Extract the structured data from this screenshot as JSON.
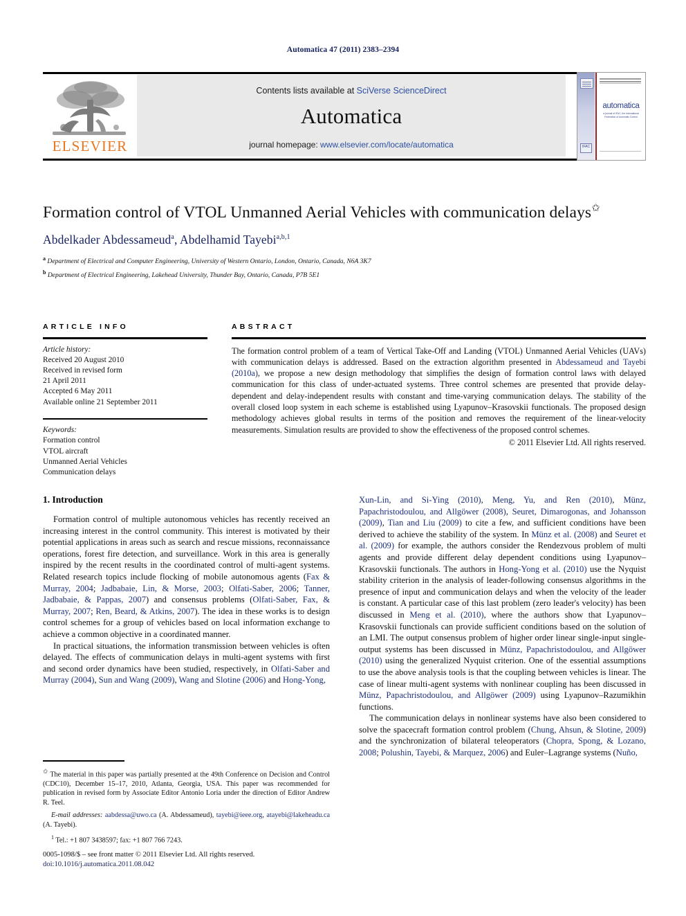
{
  "running_head": "Automatica 47 (2011) 2383–2394",
  "masthead": {
    "contents_prefix": "Contents lists available at ",
    "sciencedirect": "SciVerse ScienceDirect",
    "journal_name": "Automatica",
    "homepage_prefix": "journal homepage: ",
    "homepage_url": "www.elsevier.com/locate/automatica",
    "publisher_logo_text": "ELSEVIER",
    "cover": {
      "title": "automatica",
      "subtitle": "a journal of IFAC, the International Federation of Automatic Control",
      "ifac_label": "IFAC"
    }
  },
  "title": {
    "text": "Formation control of VTOL Unmanned Aerial Vehicles with communication delays",
    "footnote_marker": "✩"
  },
  "authors": {
    "line": "Abdelkader Abdessameud",
    "author1": "Abdelkader Abdessameud",
    "author1_sup": "a",
    "author2": "Abdelhamid Tayebi",
    "author2_sup": "a,b,1",
    "separator": ", "
  },
  "affiliations": [
    {
      "marker": "a",
      "text": "Department of Electrical and Computer Engineering, University of Western Ontario, London, Ontario, Canada, N6A 3K7"
    },
    {
      "marker": "b",
      "text": "Department of Electrical Engineering, Lakehead University, Thunder Bay, Ontario, Canada, P7B 5E1"
    }
  ],
  "article_info": {
    "heading": "ARTICLE INFO",
    "history_label": "Article history:",
    "history": [
      "Received 20 August 2010",
      "Received in revised form",
      "21 April 2011",
      "Accepted 6 May 2011",
      "Available online 21 September 2011"
    ],
    "keywords_label": "Keywords:",
    "keywords": [
      "Formation control",
      "VTOL aircraft",
      "Unmanned Aerial Vehicles",
      "Communication delays"
    ]
  },
  "abstract": {
    "heading": "ABSTRACT",
    "part1": "The formation control problem of a team of Vertical Take-Off and Landing (VTOL) Unmanned Aerial Vehicles (UAVs) with communication delays is addressed. Based on the extraction algorithm presented in ",
    "cite1": "Abdessameud and Tayebi (2010a)",
    "part2": ", we propose a new design methodology that simplifies the design of formation control laws with delayed communication for this class of under-actuated systems. Three control schemes are presented that provide delay-dependent and delay-independent results with constant and time-varying communication delays. The stability of the overall closed loop system in each scheme is established using Lyapunov–Krasovskii functionals. The proposed design methodology achieves global results in terms of the position and removes the requirement of the linear-velocity measurements. Simulation results are provided to show the effectiveness of the proposed control schemes.",
    "copyright": "© 2011 Elsevier Ltd. All rights reserved."
  },
  "body": {
    "section_heading": "1. Introduction",
    "left": {
      "p1_a": "Formation control of multiple autonomous vehicles has recently received an increasing interest in the control community. This interest is motivated by their potential applications in areas such as search and rescue missions, reconnaissance operations, forest fire detection, and surveillance. Work in this area is generally inspired by the recent results in the coordinated control of multi-agent systems. Related research topics include flocking of mobile autonomous agents (",
      "p1_c1": "Fax & Murray, 2004",
      "p1_b": "; ",
      "p1_c2": "Jadbabaie, Lin, & Morse, 2003",
      "p1_c3": "Olfati-Saber, 2006",
      "p1_c4": "Tanner, Jadbabaie, & Pappas, 2007",
      "p1_d": ") and consensus problems (",
      "p1_c5": "Olfati-Saber, Fax, & Murray, 2007",
      "p1_c6": "Ren, Beard, & Atkins, 2007",
      "p1_e": "). The idea in these works is to design control schemes for a group of vehicles based on local information exchange to achieve a common objective in a coordinated manner.",
      "p2_a": "In practical situations, the information transmission between vehicles is often delayed. The effects of communication delays in multi-agent systems with first and second order dynamics have been studied, respectively, in ",
      "p2_c1": "Olfati-Saber and Murray (2004)",
      "p2_b": ", ",
      "p2_c2": "Sun and Wang (2009)",
      "p2_c3": "Wang and Slotine (2006)",
      "p2_c": " and ",
      "p2_c4": "Hong-Yong,"
    },
    "right": {
      "p1_c1": "Xun-Lin, and Si-Ying (2010)",
      "p1_a": ", ",
      "p1_c2": "Meng, Yu, and Ren (2010)",
      "p1_c3": "Münz, Papachristodoulou, and Allgöwer (2008)",
      "p1_c4": "Seuret, Dimarogonas, and Johansson (2009)",
      "p1_c5": "Tian and Liu (2009)",
      "p1_b": " to cite a few, and sufficient conditions have been derived to achieve the stability of the system. In ",
      "p1_c6": "Münz et al. (2008)",
      "p1_c": " and ",
      "p1_c7": "Seuret et al. (2009)",
      "p1_d": " for example, the authors consider the Rendezvous problem of multi agents and provide different delay dependent conditions using Lyapunov–Krasovskii functionals. The authors in ",
      "p1_c8": "Hong-Yong et al. (2010)",
      "p1_e": " use the Nyquist stability criterion in the analysis of leader-following consensus algorithms in the presence of input and communication delays and when the velocity of the leader is constant. A particular case of this last problem (zero leader's velocity) has been discussed in ",
      "p1_c9": "Meng et al. (2010)",
      "p1_f": ", where the authors show that Lyapunov–Krasovskii functionals can provide sufficient conditions based on the solution of an LMI. The output consensus problem of higher order linear single-input single-output systems has been discussed in ",
      "p1_c10": "Münz, Papachristodoulou, and Allgöwer (2010)",
      "p1_g": " using the generalized Nyquist criterion. One of the essential assumptions to use the above analysis tools is that the coupling between vehicles is linear. The case of linear multi-agent systems with nonlinear coupling has been discussed in ",
      "p1_c11": "Münz, Papachristodoulou, and Allgöwer (2009)",
      "p1_h": " using Lyapunov–Razumikhin functions.",
      "p2_a": "The communication delays in nonlinear systems have also been considered to solve the spacecraft formation control problem (",
      "p2_c1": "Chung, Ahsun, & Slotine, 2009",
      "p2_b": ") and the synchronization of bilateral teleoperators (",
      "p2_c2": "Chopra, Spong, & Lozano, 2008",
      "p2_c": "; ",
      "p2_c3": "Polushin, Tayebi, & Marquez, 2006",
      "p2_d": ") and Euler–Lagrange systems (",
      "p2_c4": "Nuño,"
    }
  },
  "footnotes": {
    "star_marker": "✩",
    "star_text": "The material in this paper was partially presented at the 49th Conference on Decision and Control (CDC10), December 15–17, 2010, Atlanta, Georgia, USA. This paper was recommended for publication in revised form by Associate Editor Antonio Loria under the direction of Editor Andrew R. Teel.",
    "email_label": "E-mail addresses:",
    "email1": "aabdessa@uwo.ca",
    "email1_owner": " (A. Abdessameud), ",
    "email2": "tayebi@ieee.org",
    "email2_sep": ", ",
    "email3": "atayebi@lakeheadu.ca",
    "email3_owner": " (A. Tayebi).",
    "tel_marker": "1",
    "tel_text": "Tel.: +1 807 3438597; fax: +1 807 766 7243."
  },
  "bottom_meta": {
    "issn_line": "0005-1098/$ – see front matter © 2011 Elsevier Ltd. All rights reserved.",
    "doi_line": "doi:10.1016/j.automatica.2011.08.042"
  },
  "colors": {
    "link_blue": "#2b4ea2",
    "cite_navy": "#1c2f7a",
    "elsevier_orange": "#e87722",
    "band_gray": "#e9e9e9"
  }
}
